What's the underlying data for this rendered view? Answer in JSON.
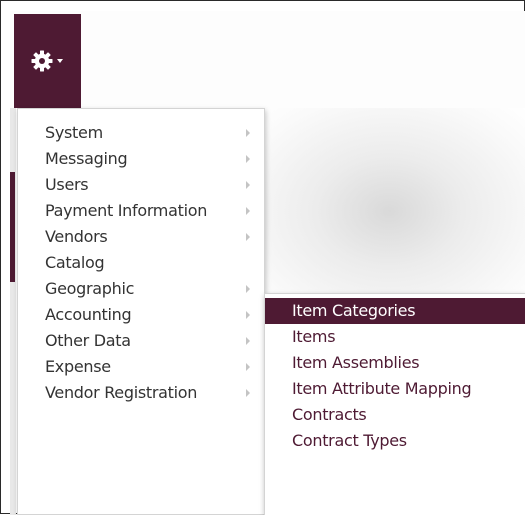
{
  "settings_button": {
    "icon": "gear-icon",
    "caret_icon": "caret-down-icon"
  },
  "main_menu": {
    "items": [
      {
        "label": "System",
        "has_submenu": true
      },
      {
        "label": "Messaging",
        "has_submenu": true
      },
      {
        "label": "Users",
        "has_submenu": true
      },
      {
        "label": "Payment Information",
        "has_submenu": true
      },
      {
        "label": "Vendors",
        "has_submenu": true
      },
      {
        "label": "Catalog",
        "has_submenu": false
      },
      {
        "label": "Geographic",
        "has_submenu": true
      },
      {
        "label": "Accounting",
        "has_submenu": true
      },
      {
        "label": "Other Data",
        "has_submenu": true
      },
      {
        "label": "Expense",
        "has_submenu": true
      },
      {
        "label": "Vendor Registration",
        "has_submenu": true
      }
    ]
  },
  "catalog_submenu": {
    "items": [
      {
        "label": "Item Categories",
        "active": true
      },
      {
        "label": "Items",
        "active": false
      },
      {
        "label": "Item Assemblies",
        "active": false
      },
      {
        "label": "Item Attribute Mapping",
        "active": false
      },
      {
        "label": "Contracts",
        "active": false
      },
      {
        "label": "Contract Types",
        "active": false
      }
    ]
  },
  "colors": {
    "brand": "#4e1a33",
    "menu_text": "#333333",
    "submenu_text": "#4e1a33",
    "arrow": "#c4c4c4"
  }
}
